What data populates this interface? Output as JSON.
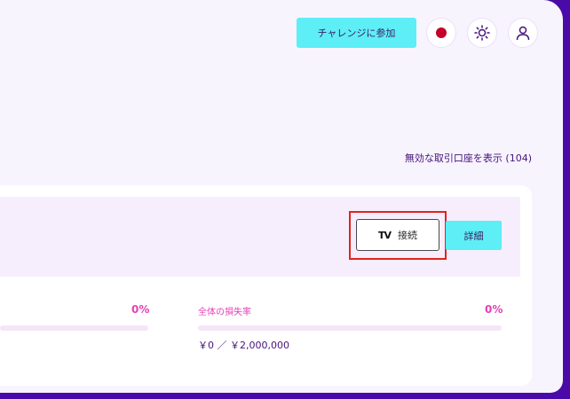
{
  "header": {
    "challenge_button": "チャレンジに参加",
    "language_icon": "japan-flag-icon",
    "theme_icon": "sun-icon",
    "account_icon": "user-icon"
  },
  "accounts": {
    "show_inactive_link": "無効な取引口座を表示 (104)"
  },
  "card": {
    "connect_button": "接続",
    "connect_logo": "TV",
    "detail_button": "詳細",
    "left_stat": {
      "percent": "0%",
      "progress": 0
    },
    "overall_loss": {
      "label": "全体の損失率",
      "percent": "0%",
      "progress": 0,
      "value": "￥0 ／ ￥2,000,000"
    }
  },
  "colors": {
    "accent_cyan": "#5deef6",
    "accent_pink": "#e73fb4",
    "frame_purple": "#4a0aa8",
    "highlight_red": "#e2241a"
  }
}
